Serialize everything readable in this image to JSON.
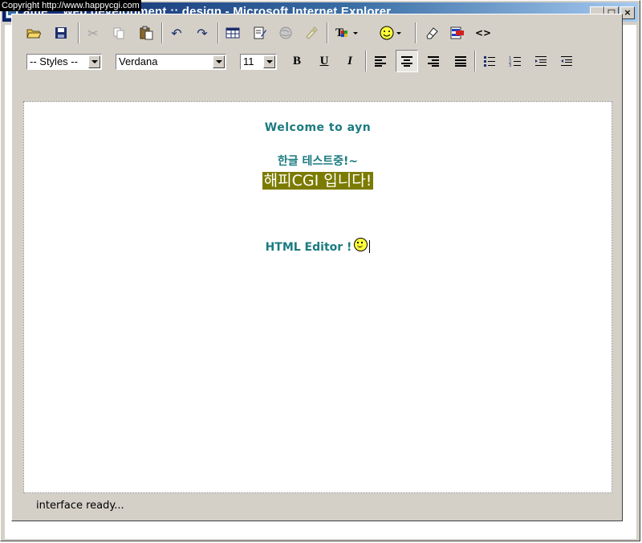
{
  "window": {
    "title": "ame :: web development :: design - Microsoft Internet Explorer",
    "overlay": "Copyright   http://www.happycgi.com"
  },
  "toolbar": {
    "row1_icons": [
      "open-folder-icon",
      "save-icon",
      "cut-icon",
      "copy-icon",
      "paste-icon",
      "undo-icon",
      "redo-icon",
      "table-icon",
      "form-edit-icon",
      "globe-icon",
      "image-insert-icon",
      "text-color-icon",
      "smiley-icon",
      "eraser-icon",
      "strike-special-icon",
      "source-code-icon"
    ],
    "styles_select": "-- Styles --",
    "font_select": "Verdana",
    "size_select": "11",
    "bold_label": "B",
    "underline_label": "U",
    "italic_label": "I",
    "source_label": "<>"
  },
  "content": {
    "line1": "Welcome to ayn",
    "line2": "한글 테스트중!~",
    "line3": "해피CGI 입니다!",
    "line4": "HTML Editor !"
  },
  "status": {
    "text": "interface ready..."
  },
  "colors": {
    "content_text": "#1b7b80",
    "highlight_bg": "#7b7b00",
    "chrome": "#d4d0c8"
  }
}
